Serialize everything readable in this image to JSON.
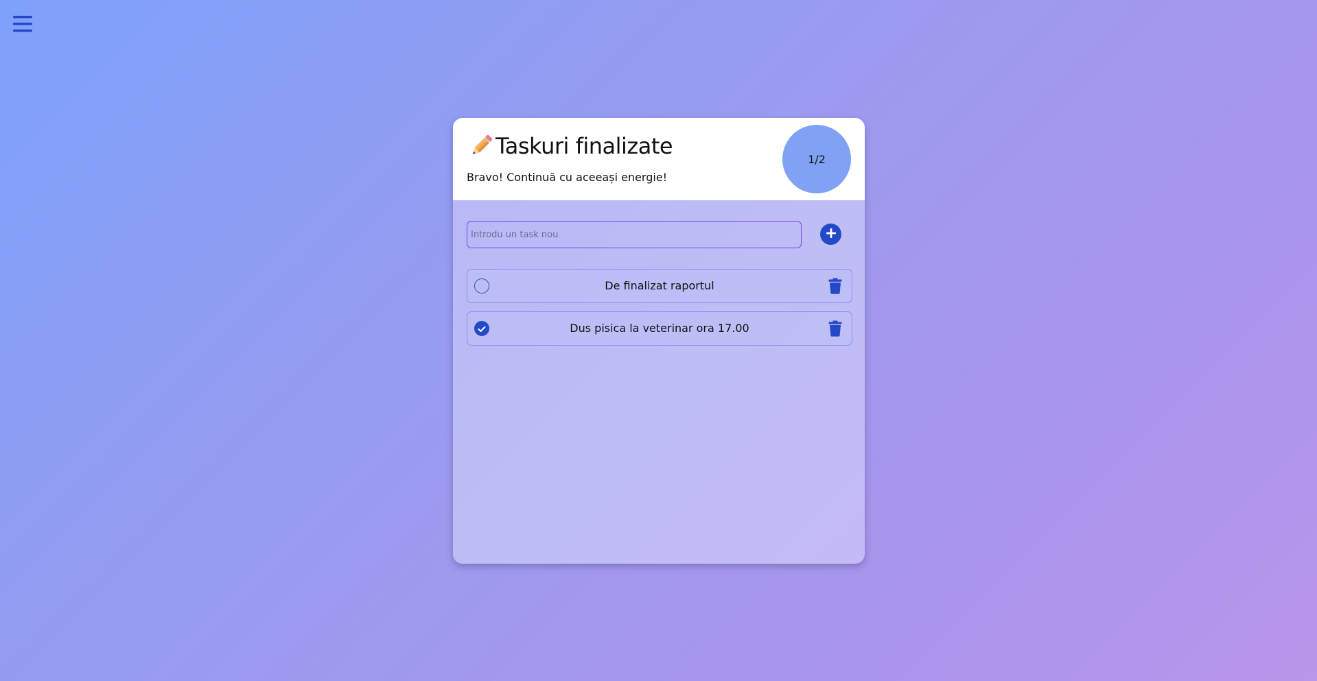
{
  "header": {
    "title": "Taskuri finalizate",
    "subtitle": "Bravo! Continuă cu aceeași energie!",
    "progress_text": "1/2"
  },
  "add_task": {
    "placeholder": "Introdu un task nou"
  },
  "tasks": [
    {
      "text": "De finalizat raportul",
      "completed": false
    },
    {
      "text": "Dus pisica la veterinar ora 17.00",
      "completed": true
    }
  ],
  "icons": {
    "menu": "hamburger-menu-icon",
    "title": "pencil-icon",
    "add": "plus-circle-icon",
    "delete": "trash-icon",
    "check": "check-icon"
  },
  "colors": {
    "accent": "#2449c8",
    "progress_circle": "#7fa2f4",
    "input_border": "#7b3ff0",
    "background_start": "#7ea1fb",
    "background_end": "#b896ea"
  }
}
